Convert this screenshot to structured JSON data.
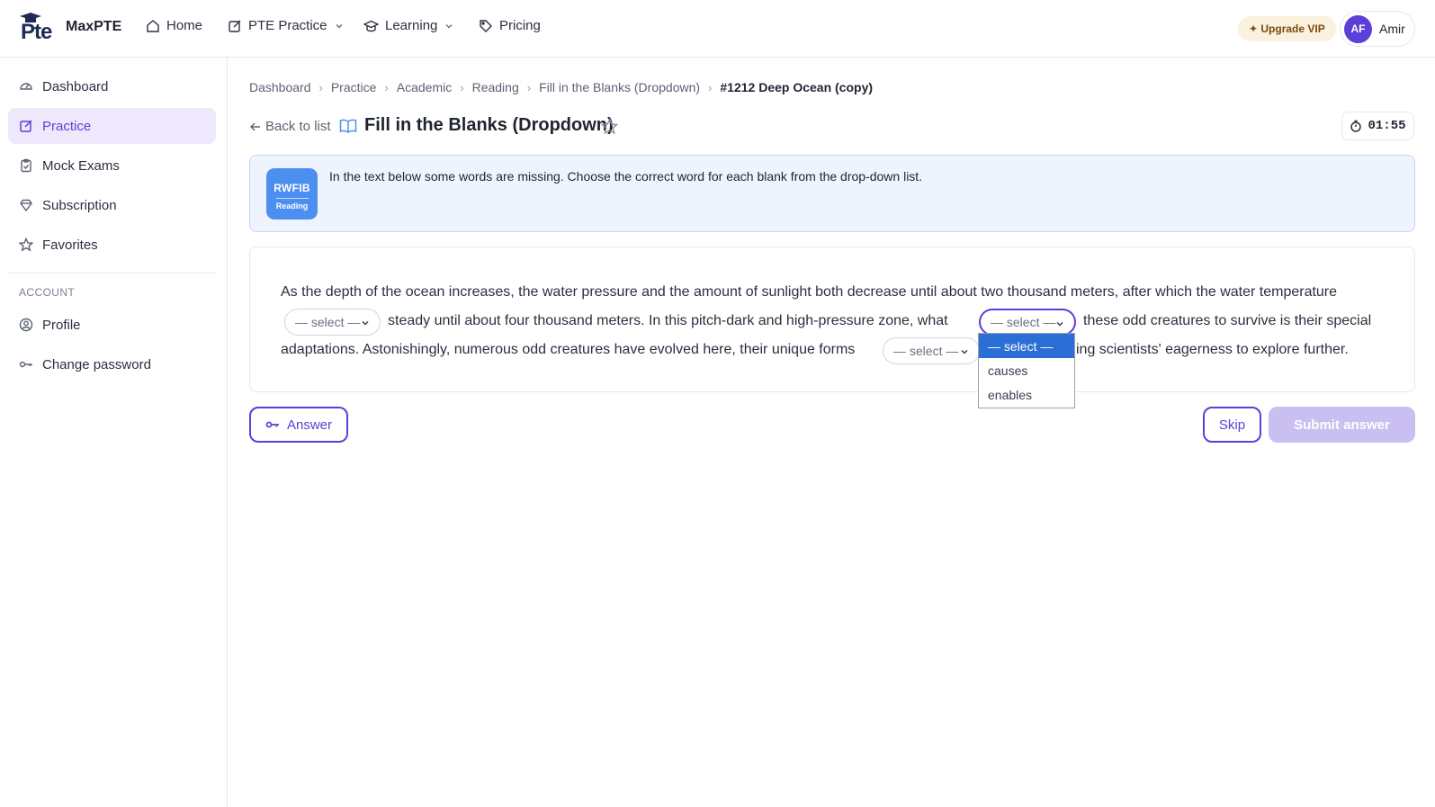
{
  "header": {
    "brand": "MaxPTE",
    "logo_text": "Pte",
    "nav": [
      {
        "label": "Home",
        "icon": "home-icon"
      },
      {
        "label": "PTE Practice",
        "icon": "edit-icon",
        "dropdown": true
      },
      {
        "label": "Learning",
        "icon": "graduation-cap-icon",
        "dropdown": true
      },
      {
        "label": "Pricing",
        "icon": "tag-icon"
      }
    ],
    "upgrade_label": "✦ Upgrade VIP",
    "user": {
      "initials": "AF",
      "name": "Amir"
    }
  },
  "sidebar": {
    "items": [
      {
        "label": "Dashboard",
        "icon": "gauge-icon",
        "active": false
      },
      {
        "label": "Practice",
        "icon": "edit-icon",
        "active": true
      },
      {
        "label": "Mock Exams",
        "icon": "clipboard-icon",
        "active": false
      },
      {
        "label": "Subscription",
        "icon": "diamond-icon",
        "active": false
      },
      {
        "label": "Favorites",
        "icon": "star-icon",
        "active": false
      }
    ],
    "account_section": "ACCOUNT",
    "account_items": [
      {
        "label": "Profile",
        "icon": "user-circle-icon"
      },
      {
        "label": "Change password",
        "icon": "key-icon"
      }
    ]
  },
  "breadcrumb": [
    "Dashboard",
    "Practice",
    "Academic",
    "Reading",
    "Fill in the Blanks (Dropdown)",
    "#1212 Deep Ocean (copy)"
  ],
  "page": {
    "back_label": "Back to list",
    "title": "Fill in the Blanks (Dropdown)",
    "timer": "01:55"
  },
  "instruction": {
    "badge_code": "RWFIB",
    "badge_type": "Reading",
    "text": "In the text below some words are missing. Choose the correct word for each blank from the drop-down list."
  },
  "passage": {
    "line1": "As the depth of the ocean increases, the water pressure and the amount of sunlight both decrease until about two thousand meters, after which the water temperature",
    "line2_a": "steady until about four thousand meters. In this pitch-dark and high-pressure zone, what",
    "line2_b": "these odd creatures to survive is their special",
    "line3_a": "adaptations. Astonishingly, numerous odd creatures have evolved here, their unique forms",
    "line3_b": "ing scientists' eagerness to explore further.",
    "select_placeholder": "— select —",
    "open_options": [
      "— select —",
      "causes",
      "enables"
    ]
  },
  "actions": {
    "answer_label": "Answer",
    "skip_label": "Skip",
    "submit_label": "Submit answer"
  },
  "colors": {
    "accent": "#5b3fd6",
    "accent_light": "#ede8fb",
    "info_bg": "#eef3fd",
    "badge_blue": "#4d8ff0",
    "option_highlight": "#2b6ed6"
  }
}
